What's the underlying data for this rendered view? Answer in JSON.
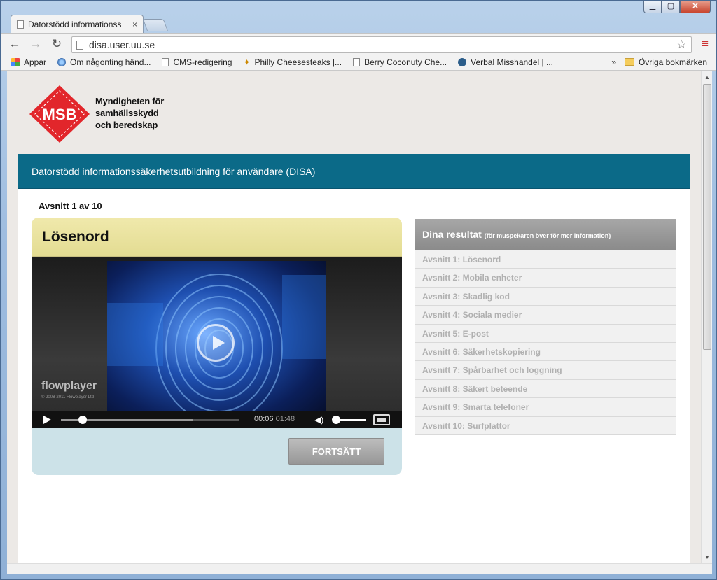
{
  "browser": {
    "tab_title": "Datorstödd informationss",
    "tab_close": "×",
    "url": "disa.user.uu.se",
    "bookmarks": [
      {
        "label": "Appar",
        "icon": "apps-grid-icon"
      },
      {
        "label": "Om någonting händ...",
        "icon": "globe-icon"
      },
      {
        "label": "CMS-redigering",
        "icon": "page-icon"
      },
      {
        "label": "Philly Cheesesteaks |...",
        "icon": "butterfly-icon"
      },
      {
        "label": "Berry Coconuty Che...",
        "icon": "page-icon"
      },
      {
        "label": "Verbal Misshandel | ...",
        "icon": "wave-icon"
      }
    ],
    "bookmarks_more": "»",
    "other_bookmarks": "Övriga bokmärken"
  },
  "logo": {
    "mark": "MSB",
    "line1": "Myndigheten för",
    "line2": "samhällsskydd",
    "line3": "och beredskap"
  },
  "banner": {
    "title": "Datorstödd informationssäkerhetsutbildning för användare (DISA)"
  },
  "section": {
    "label": "Avsnitt 1 av 10"
  },
  "lesson": {
    "title": "Lösenord",
    "player": {
      "brand": "flowplayer",
      "copyright": "© 2008-2011 Flowplayer Ltd",
      "current_time": "00:06",
      "duration": "01:48",
      "progress": 0.06,
      "buffered": 0.74,
      "volume": 1.0
    },
    "next_button": "FORTSÄTT"
  },
  "results": {
    "title": "Dina resultat",
    "hint": "(för muspekaren över för mer information)",
    "items": [
      "Avsnitt 1: Lösenord",
      "Avsnitt 2: Mobila enheter",
      "Avsnitt 3: Skadlig kod",
      "Avsnitt 4: Sociala medier",
      "Avsnitt 5: E-post",
      "Avsnitt 6: Säkerhetskopiering",
      "Avsnitt 7: Spårbarhet och loggning",
      "Avsnitt 8: Säkert beteende",
      "Avsnitt 9: Smarta telefoner",
      "Avsnitt 10: Surfplattor"
    ]
  },
  "colors": {
    "banner": "#0b6a88",
    "lesson_header": "#e8e19c",
    "lesson_body": "#cce2e8",
    "logo_red": "#e2262b"
  }
}
